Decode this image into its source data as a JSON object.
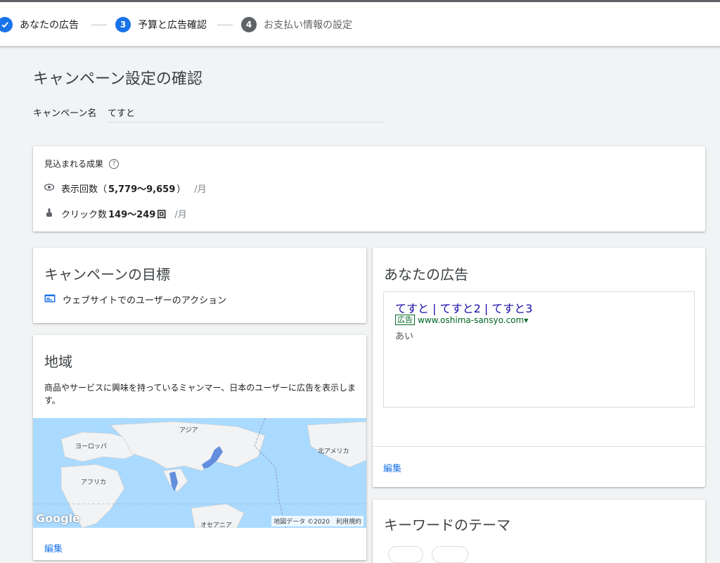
{
  "stepper": {
    "steps": [
      {
        "number": "",
        "label": "あなたの広告",
        "state": "done"
      },
      {
        "number": "3",
        "label": "予算と広告確認",
        "state": "current"
      },
      {
        "number": "4",
        "label": "お支払い情報の設定",
        "state": "todo"
      }
    ]
  },
  "page": {
    "title": "キャンペーン設定の確認",
    "campaign_name_label": "キャンペーン名",
    "campaign_name_value": "てすと"
  },
  "performance": {
    "title": "見込まれる成果",
    "help_icon": "help-circle-icon",
    "impressions_label": "表示回数（",
    "impressions_range": "5,779〜9,659",
    "impressions_close": "）",
    "impressions_unit": "/月",
    "clicks_label": "クリック数",
    "clicks_range": "149〜249",
    "clicks_suffix": "回",
    "clicks_unit": "/月"
  },
  "goal_card": {
    "title": "キャンペーンの目標",
    "item": "ウェブサイトでのユーザーのアクション"
  },
  "region_card": {
    "title": "地域",
    "description": "商品やサービスに興味を持っているミャンマー、日本のユーザーに広告を表示します。",
    "map_labels": {
      "asia": "アジア",
      "europe": "ヨーロッパ",
      "africa": "アフリカ",
      "north_america": "北アメリカ",
      "oceania": "オセアニア"
    },
    "google_logo": "Google",
    "map_attribution": "地図データ ©2020　利用規約",
    "edit": "編集"
  },
  "ad_card": {
    "title": "あなたの広告",
    "headline": "てすと | てすと2 | てすと3",
    "badge": "広告",
    "url": "www.oshima-sansyo.com▾",
    "description": "あい",
    "edit": "編集"
  },
  "keyword_card": {
    "title": "キーワードのテーマ"
  },
  "colors": {
    "accent": "#1a73e8",
    "ad_headline": "#1a0dab",
    "ad_url": "#006621",
    "map_water": "#aadaff",
    "highlight_region": "#4a7bd8"
  }
}
